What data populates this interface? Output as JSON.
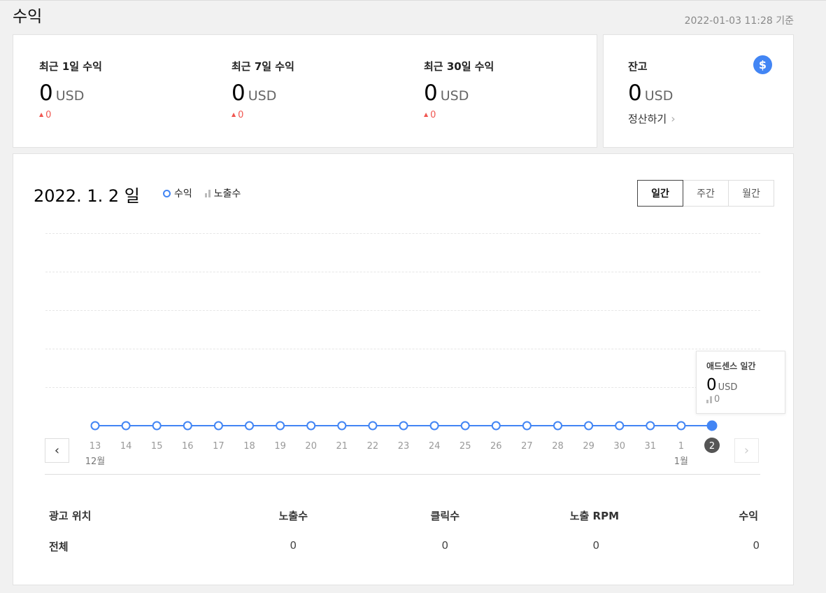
{
  "header": {
    "title": "수익",
    "timestamp": "2022-01-03 11:28 기준"
  },
  "summary": [
    {
      "label": "최근 1일 수익",
      "value": "0",
      "unit": "USD",
      "delta": "0"
    },
    {
      "label": "최근 7일 수익",
      "value": "0",
      "unit": "USD",
      "delta": "0"
    },
    {
      "label": "최근 30일 수익",
      "value": "0",
      "unit": "USD",
      "delta": "0"
    }
  ],
  "balance": {
    "label": "잔고",
    "value": "0",
    "unit": "USD",
    "settle_label": "정산하기",
    "icon": "dollar-icon",
    "icon_glyph": "$"
  },
  "chart": {
    "date": "2022. 1. 2 일",
    "legend": {
      "revenue": "수익",
      "impressions": "노출수"
    },
    "tabs": [
      {
        "label": "일간",
        "active": true
      },
      {
        "label": "주간",
        "active": false
      },
      {
        "label": "월간",
        "active": false
      }
    ],
    "tooltip": {
      "title": "애드센스 일간",
      "value": "0",
      "unit": "USD",
      "impressions": "0"
    }
  },
  "chart_data": {
    "type": "line",
    "x": [
      "13",
      "14",
      "15",
      "16",
      "17",
      "18",
      "19",
      "20",
      "21",
      "22",
      "23",
      "24",
      "25",
      "26",
      "27",
      "28",
      "29",
      "30",
      "31",
      "1",
      "2"
    ],
    "month_labels": [
      {
        "at": "13",
        "label": "12월"
      },
      {
        "at": "1",
        "label": "1월"
      }
    ],
    "series": [
      {
        "name": "수익",
        "values": [
          0,
          0,
          0,
          0,
          0,
          0,
          0,
          0,
          0,
          0,
          0,
          0,
          0,
          0,
          0,
          0,
          0,
          0,
          0,
          0,
          0
        ]
      }
    ],
    "selected": "2",
    "grid": true,
    "line_color": "#4285f4"
  },
  "table": {
    "headers": [
      "광고 위치",
      "노출수",
      "클릭수",
      "노출 RPM",
      "수익"
    ],
    "rows": [
      [
        "전체",
        "0",
        "0",
        "0",
        "0"
      ]
    ]
  },
  "colors": {
    "accent": "#4285f4",
    "delta_up": "#f05650"
  }
}
